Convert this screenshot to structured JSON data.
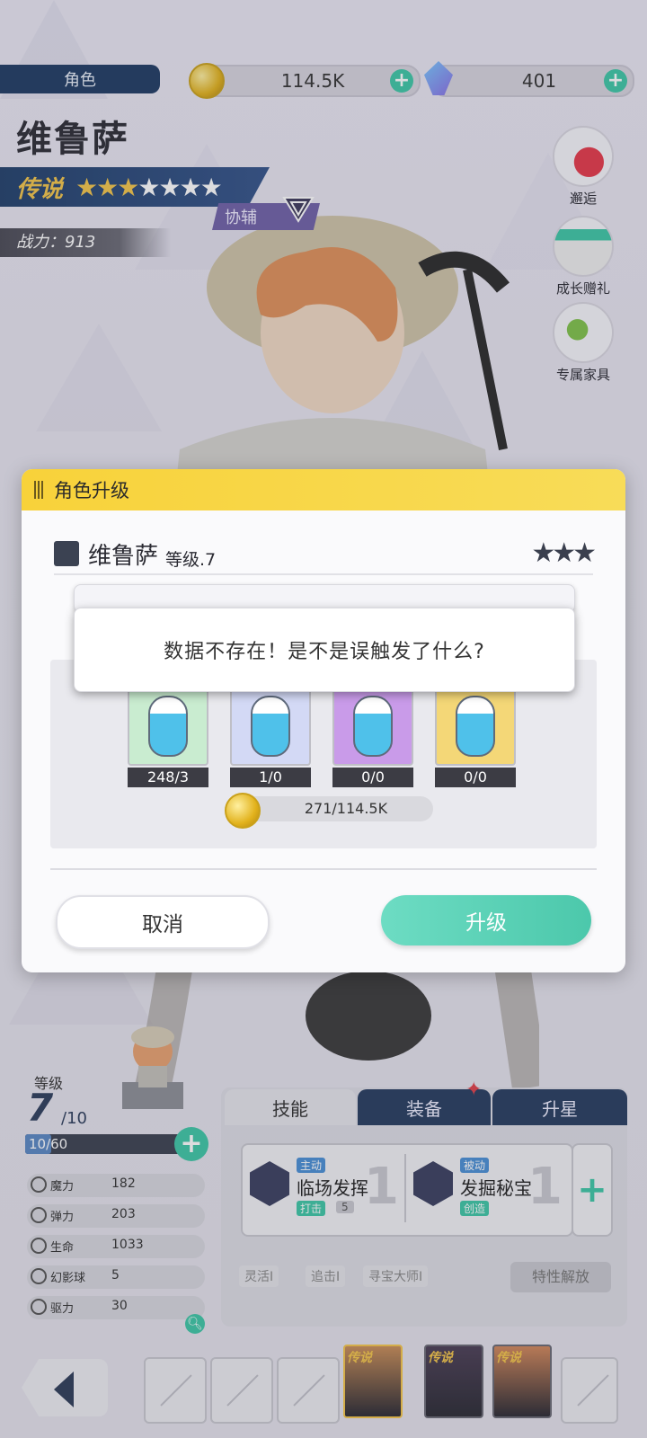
{
  "top": {
    "page_tab": "角色",
    "coins": "114.5K",
    "gems": "401"
  },
  "character": {
    "name": "维鲁萨",
    "rank": "传说",
    "stars_filled": 3,
    "stars_total": 7,
    "role": "协辅",
    "power": "战力：913"
  },
  "side_buttons": [
    {
      "label": "邂逅",
      "icon": "gift-heart-icon"
    },
    {
      "label": "成长赠礼",
      "icon": "gift-box-icon"
    },
    {
      "label": "专属家具",
      "icon": "furniture-icon"
    }
  ],
  "modal": {
    "title": "角色升级",
    "char_name": "维鲁萨",
    "level_text": "等级.7",
    "potions": [
      {
        "count": "248/3",
        "bg": "#c9ecd0"
      },
      {
        "count": "1/0",
        "bg": "#d3d9f5"
      },
      {
        "count": "0/0",
        "bg": "#c99be9"
      },
      {
        "count": "0/0",
        "bg": "#f4d777"
      }
    ],
    "coin_need": "271/114.5K",
    "cancel_label": "取消",
    "upgrade_label": "升级"
  },
  "toast": {
    "message": "数据不存在！是不是误触发了什么?"
  },
  "level_panel": {
    "label": "等级",
    "level": "7",
    "max": "/10",
    "exp_text": "10/60",
    "exp_fraction": 0.167
  },
  "stats": [
    {
      "name": "魔力",
      "value": "182"
    },
    {
      "name": "弹力",
      "value": "203"
    },
    {
      "name": "生命",
      "value": "1033"
    },
    {
      "name": "幻影球",
      "value": "5"
    },
    {
      "name": "驱力",
      "value": "30"
    }
  ],
  "tabs": {
    "skill": "技能",
    "equip": "装备",
    "star": "升星"
  },
  "skills": [
    {
      "type": "主动",
      "name": "临场发挥",
      "tag": "打击",
      "cd": "5",
      "level": "1"
    },
    {
      "type": "被动",
      "name": "发掘秘宝",
      "tag": "创造",
      "level": "1"
    }
  ],
  "traits": [
    "灵活I",
    "追击I",
    "寻宝大师I"
  ],
  "unlock_label": "特性解放",
  "roster": [
    {
      "rank": "传说",
      "color": "#c98d57"
    },
    {
      "rank": "传说",
      "color": "#4b3e55"
    },
    {
      "rank": "传说",
      "color": "#d2875a"
    }
  ],
  "colors": {
    "accent": "#3ec7a6",
    "navy": "#263c60",
    "gold": "#f4c64a"
  }
}
